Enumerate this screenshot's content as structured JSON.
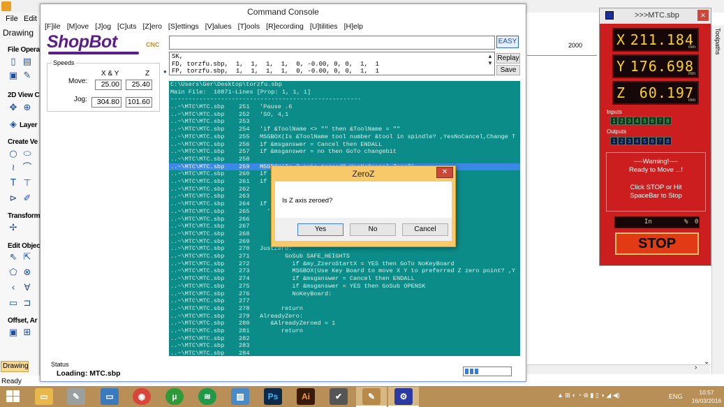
{
  "background_app": {
    "menu": [
      "File",
      "Edit"
    ],
    "drawing_tab": "Drawing",
    "sections": [
      "File Opera",
      "2D View C",
      "Layer",
      "Create Ve",
      "Transform",
      "Edit Objec",
      "Offset, Ar"
    ],
    "bottom_tab": "Drawing",
    "status": "Ready",
    "ruler_label": "2000",
    "toolpaths_label": "Toolpaths"
  },
  "console": {
    "title": "Command Console",
    "menu": [
      "[F]ile",
      "[M]ove",
      "[J]og",
      "[C]uts",
      "[Z]ero",
      "[S]ettings",
      "[V]alues",
      "[T]ools",
      "[R]ecording",
      "[U]tilities",
      "[H]elp"
    ],
    "logo": {
      "name": "ShopBot",
      "suffix": "CNC"
    },
    "speeds": {
      "title": "Speeds",
      "xy_label": "X & Y",
      "z_label": "Z",
      "move_label": "Move:",
      "jog_label": "Jog:",
      "move_xy": "25.00",
      "move_z": "25.40",
      "jog_xy": "304.80",
      "jog_z": "101.60"
    },
    "command_input": "",
    "buttons": {
      "easy": "EASY",
      "replay": "Replay",
      "save": "Save"
    },
    "history": [
      "SK,",
      "FD, torzfu.sbp,  1,  1,  1,  1,  0, -0.00, 0, 0,  1,  1",
      "FP, torzfu.sbp,  1,  1,  1,  1,  0, -0.00, 0, 0,  1,  1"
    ],
    "file_view": {
      "path": "C:\\Users\\Ger\\Desktop\\torzfu.sbp",
      "main_file": "Main File:  10871-Lines [Prop: 1, 1, 1]",
      "separator": "-----------------------------------------------------",
      "rows": [
        {
          "file": "..~\\MTC\\MTC.sbp",
          "num": "251",
          "code": "'Pause .6"
        },
        {
          "file": "..~\\MTC\\MTC.sbp",
          "num": "252",
          "code": "'SO, 4,1"
        },
        {
          "file": "..~\\MTC\\MTC.sbp",
          "num": "253",
          "code": ""
        },
        {
          "file": "..~\\MTC\\MTC.sbp",
          "num": "254",
          "code": "'if &ToolName <> \"\" then &ToolName = \"\""
        },
        {
          "file": "..~\\MTC\\MTC.sbp",
          "num": "255",
          "code": "MSGBOX(Is &ToolName tool number &tool in spindle? ,YesNoCancel,Change T"
        },
        {
          "file": "..~\\MTC\\MTC.sbp",
          "num": "256",
          "code": "if &msganswer = Cancel then ENDALL"
        },
        {
          "file": "..~\\MTC\\MTC.sbp",
          "num": "257",
          "code": "if &msganswer = no then GoTo changebit"
        },
        {
          "file": "..~\\MTC\\MTC.sbp",
          "num": "258",
          "code": ""
        },
        {
          "file": "..~\\MTC\\MTC.sbp",
          "num": "259",
          "code": "MSGBOX(Is Z axis zeroed?,YesNoCancel,ZeroZ)",
          "highlight": true
        },
        {
          "file": "..~\\MTC\\MTC.sbp",
          "num": "260",
          "code": "if &"
        },
        {
          "file": "..~\\MTC\\MTC.sbp",
          "num": "261",
          "code": "if &"
        },
        {
          "file": "..~\\MTC\\MTC.sbp",
          "num": "262",
          "code": ""
        },
        {
          "file": "..~\\MTC\\MTC.sbp",
          "num": "263",
          "code": ""
        },
        {
          "file": "..~\\MTC\\MTC.sbp",
          "num": "264",
          "code": "if"
        },
        {
          "file": "..~\\MTC\\MTC.sbp",
          "num": "265",
          "code": "  '                               start the routin"
        },
        {
          "file": "..~\\MTC\\MTC.sbp",
          "num": "266",
          "code": ""
        },
        {
          "file": "..~\\MTC\\MTC.sbp",
          "num": "267",
          "code": ""
        },
        {
          "file": "..~\\MTC\\MTC.sbp",
          "num": "268",
          "code": ""
        },
        {
          "file": "..~\\MTC\\MTC.sbp",
          "num": "269",
          "code": ""
        },
        {
          "file": "..~\\MTC\\MTC.sbp",
          "num": "270",
          "code": "JustZero:"
        },
        {
          "file": "..~\\MTC\\MTC.sbp",
          "num": "271",
          "code": "       GoSub SAFE_HEIGHTS"
        },
        {
          "file": "..~\\MTC\\MTC.sbp",
          "num": "272",
          "code": "         if &my_ZzeroStartX = YES then GoTo NoKeyBoard"
        },
        {
          "file": "..~\\MTC\\MTC.sbp",
          "num": "273",
          "code": "         MSGBOX(Use Key Board to move X Y to preferred Z zero point? ,Y"
        },
        {
          "file": "..~\\MTC\\MTC.sbp",
          "num": "274",
          "code": "         if &msganswer = Cancel then ENDALL"
        },
        {
          "file": "..~\\MTC\\MTC.sbp",
          "num": "275",
          "code": "         if &msganswer = YES then GoSub OPENSK"
        },
        {
          "file": "..~\\MTC\\MTC.sbp",
          "num": "276",
          "code": "         NoKeyBoard:"
        },
        {
          "file": "..~\\MTC\\MTC.sbp",
          "num": "277",
          "code": ""
        },
        {
          "file": "..~\\MTC\\MTC.sbp",
          "num": "278",
          "code": "      return"
        },
        {
          "file": "..~\\MTC\\MTC.sbp",
          "num": "279",
          "code": "AlreadyZero:"
        },
        {
          "file": "..~\\MTC\\MTC.sbp",
          "num": "280",
          "code": "   &AlreadyZeroed = 1"
        },
        {
          "file": "..~\\MTC\\MTC.sbp",
          "num": "281",
          "code": "      return"
        },
        {
          "file": "..~\\MTC\\MTC.sbp",
          "num": "282",
          "code": ""
        },
        {
          "file": "..~\\MTC\\MTC.sbp",
          "num": "283",
          "code": ""
        },
        {
          "file": "..~\\MTC\\MTC.sbp",
          "num": "284",
          "code": ""
        }
      ]
    },
    "status": {
      "title": "Status",
      "text": "Loading: MTC.sbp",
      "progress": 0.3
    }
  },
  "dialog": {
    "title": "ZeroZ",
    "message": "Is Z axis zeroed?",
    "buttons": {
      "yes": "Yes",
      "no": "No",
      "cancel": "Cancel"
    },
    "close": "✕"
  },
  "dro": {
    "title": ">>>MTC.sbp",
    "x": {
      "label": "X",
      "value": "211.184",
      "unit": "mm"
    },
    "y": {
      "label": "Y",
      "value": "176.698",
      "unit": "mm"
    },
    "z": {
      "label": "Z",
      "value": "60.197",
      "unit": "mm"
    },
    "inputs_label": "Inputs",
    "inputs": [
      "1",
      "2",
      "3",
      "4",
      "5",
      "6",
      "7",
      "8"
    ],
    "outputs_label": "Outputs",
    "outputs": [
      "1",
      "2",
      "3",
      "4",
      "5",
      "6",
      "7",
      "8"
    ],
    "warning": [
      "----Warning!----",
      "Ready to Move ...!",
      "Click STOP or Hit",
      "SpaceBar to Stop"
    ],
    "units": "In",
    "units_pct": "%",
    "units_zero": "0",
    "stop_label": "STOP",
    "colors": {
      "panel": "#cc1e1e",
      "readout": "#ffd21a"
    }
  },
  "taskbar": {
    "apps": [
      "file-explorer",
      "vcarve",
      "window",
      "chrome",
      "utorrent",
      "spotify",
      "photos",
      "photoshop",
      "illustrator",
      "shopbot-tool",
      "vcarve-active",
      "shopbot-active"
    ],
    "ps_label": "Ps",
    "ai_label": "Ai",
    "lang": "ENG",
    "time": "10:57",
    "date": "16/03/2016"
  }
}
